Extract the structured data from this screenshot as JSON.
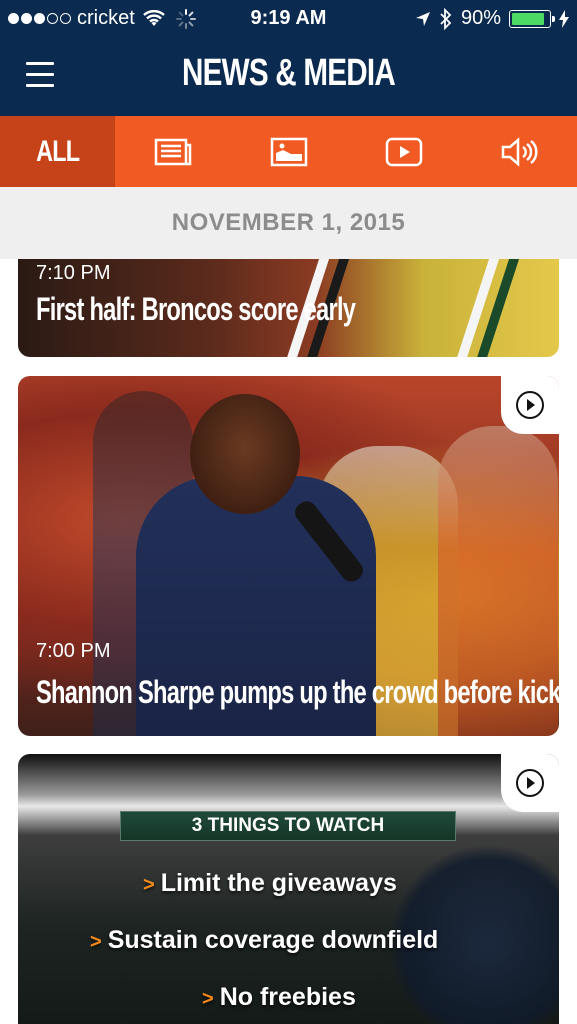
{
  "status_bar": {
    "carrier": "cricket",
    "time": "9:19 AM",
    "battery": "90%",
    "signal_bars_filled": 3,
    "signal_bars_total": 5
  },
  "header": {
    "title": "NEWS & MEDIA",
    "menu_icon": "hamburger-menu-icon"
  },
  "tabs": [
    {
      "label": "ALL",
      "icon": "",
      "active": true
    },
    {
      "label": "",
      "icon": "article-icon",
      "active": false
    },
    {
      "label": "",
      "icon": "photo-icon",
      "active": false
    },
    {
      "label": "",
      "icon": "video-play-icon",
      "active": false
    },
    {
      "label": "",
      "icon": "audio-speaker-icon",
      "active": false
    }
  ],
  "date_header": "NOVEMBER 1, 2015",
  "feed": [
    {
      "time": "7:10 PM",
      "title": "First half: Broncos score early",
      "type": "article"
    },
    {
      "time": "7:00 PM",
      "title": "Shannon Sharpe pumps up the crowd before kickoff",
      "type": "video"
    },
    {
      "time": "",
      "title": "",
      "type": "video",
      "graphic": {
        "banner": "3 THINGS TO WATCH",
        "bullets": [
          "Limit the giveaways",
          "Sustain coverage downfield",
          "No freebies"
        ]
      }
    }
  ],
  "colors": {
    "navy": "#0b2a4f",
    "orange": "#f15a22",
    "orange_active": "#c6431a",
    "date_band_bg": "#efefef",
    "date_text": "#8c8c8c"
  }
}
